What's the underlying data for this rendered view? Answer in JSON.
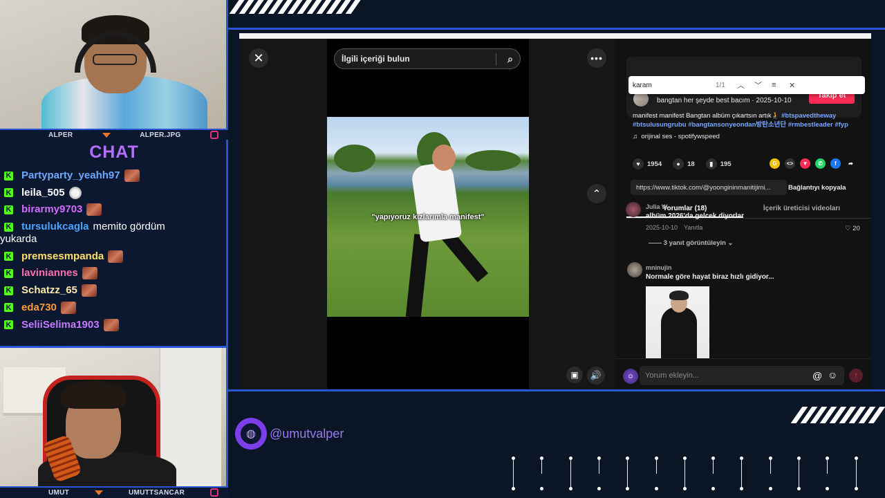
{
  "cams": {
    "top": {
      "left_name": "ALPER",
      "right_name": "ALPER.JPG"
    },
    "bottom": {
      "left_name": "UMUT",
      "right_name": "UMUTTSANCAR"
    }
  },
  "chat": {
    "title": "CHAT",
    "badge": "K",
    "messages": [
      {
        "user": "Partyparty_yeahh97",
        "color": "#6fa8ff",
        "text": "",
        "emote": "emote"
      },
      {
        "user": "leila_505",
        "color": "#ffffff",
        "text": "",
        "emote": "white"
      },
      {
        "user": "birarmy9703",
        "color": "#d26bff",
        "text": "",
        "emote": "emote"
      },
      {
        "user": "tursulukcagla",
        "color": "#4aa4ff",
        "text": "memito gördüm",
        "wrap": "yukarda"
      },
      {
        "user": "premsesmpanda",
        "color": "#ffe066",
        "text": "",
        "emote": "emote"
      },
      {
        "user": "laviniannes",
        "color": "#ff6fae",
        "text": "",
        "emote": "emote"
      },
      {
        "user": "Schatzz_65",
        "color": "#ffe9b0",
        "text": "",
        "emote": "emote"
      },
      {
        "user": "eda730",
        "color": "#ff9a3c",
        "text": "",
        "emote": "emote"
      },
      {
        "user": "SeliiSelima1903",
        "color": "#c67bff",
        "text": "",
        "emote": "emote"
      }
    ]
  },
  "video": {
    "search_placeholder": "İlgili içeriği bulun",
    "caption": "\"yapıyoruz kızlarımla manifest\"",
    "close_icon": "close-icon",
    "more_icon": "more-icon",
    "up_icon": "chevron-up-icon"
  },
  "find_bar": {
    "query": "karam",
    "count": "1/1"
  },
  "post": {
    "author_line": "bangtan her şeyde best bacım · 2025-10-10",
    "follow_label": "Takip et",
    "desc_text": "manifest manifest Bangtan albüm çıkartsın artık🧎",
    "tags": [
      "#btspavedtheway",
      "#btsulusungrubu",
      "#bangtansonyeondan방탄소년단",
      "#rmbestleader",
      "#fyp"
    ],
    "sound": "orijinal ses - spotifywspeed",
    "likes": "1954",
    "comments": "18",
    "saves": "195",
    "link": "https://www.tiktok.com/@yoongininmanitijimi...",
    "copy_label": "Bağlantıyı kopyala"
  },
  "tabs": [
    {
      "label": "Yorumlar (18)"
    },
    {
      "label": "İçerik üreticisi videoları"
    }
  ],
  "comments": [
    {
      "user": "Julia W.",
      "text": "albüm 2026'da gelcek diyorlar",
      "date": "2025-10-10",
      "reply": "Yanıtla",
      "likes": "20",
      "replies": "3 yanıt görüntüleyin"
    },
    {
      "user": "mninujin",
      "text": "Normale göre hayat biraz hızlı gidiyor..."
    }
  ],
  "comment_input": {
    "placeholder": "Yorum ekleyin..."
  },
  "social": {
    "handle": "@umutvalper"
  }
}
